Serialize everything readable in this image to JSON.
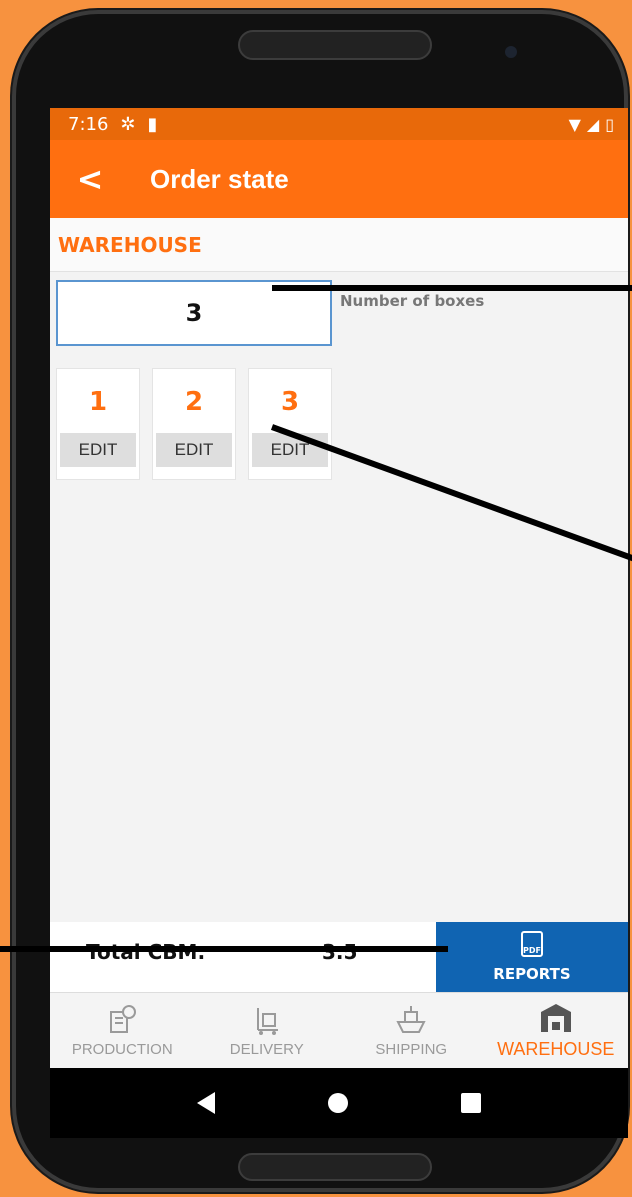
{
  "status_bar": {
    "time": "7:16"
  },
  "app_bar": {
    "title": "Order state"
  },
  "section": {
    "title": "WAREHOUSE"
  },
  "boxes": {
    "value": "3",
    "label": "Number of boxes"
  },
  "box_cards": [
    {
      "number": "1",
      "edit_label": "EDIT"
    },
    {
      "number": "2",
      "edit_label": "EDIT"
    },
    {
      "number": "3",
      "edit_label": "EDIT"
    }
  ],
  "totals": {
    "label": "Total CBM:",
    "value": "3.5",
    "reports_label": "REPORTS",
    "pdf_icon_text": "PDF"
  },
  "tabs": [
    {
      "label": "PRODUCTION",
      "icon": "production-icon",
      "active": false
    },
    {
      "label": "DELIVERY",
      "icon": "delivery-icon",
      "active": false
    },
    {
      "label": "SHIPPING",
      "icon": "shipping-icon",
      "active": false
    },
    {
      "label": "WAREHOUSE",
      "icon": "warehouse-icon",
      "active": true
    }
  ],
  "colors": {
    "accent": "#ff6f10",
    "reports": "#1064b2",
    "background": "#f7923f"
  }
}
